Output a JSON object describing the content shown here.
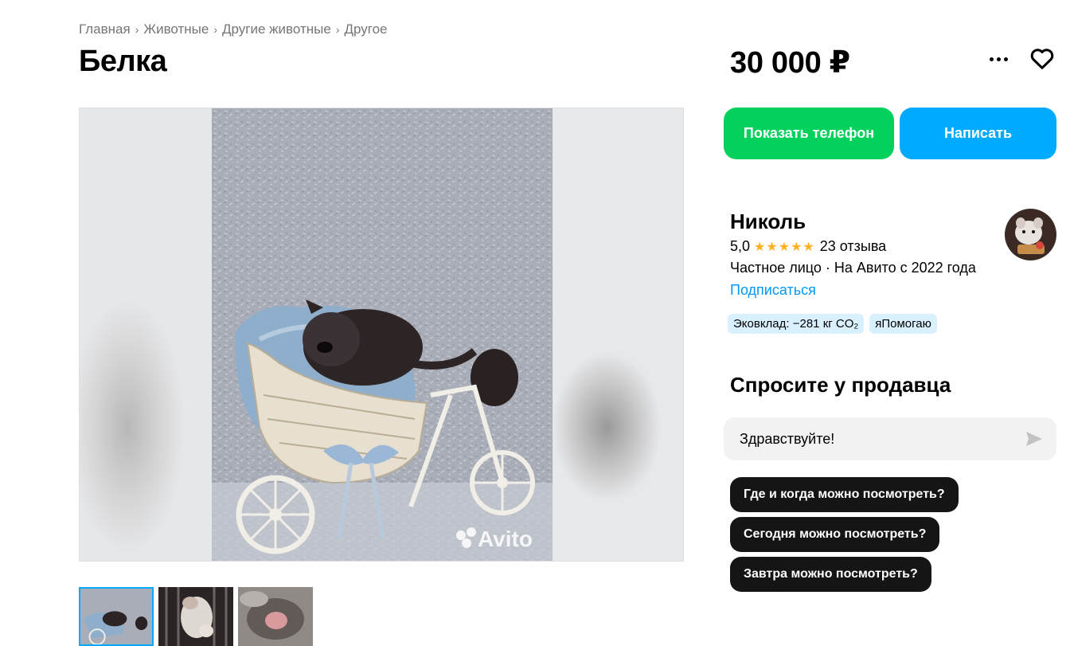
{
  "breadcrumb": [
    "Главная",
    "Животные",
    "Другие животные",
    "Другое"
  ],
  "breadcrumb_separator": "›",
  "listing": {
    "title": "Белка",
    "price": "30 000 ₽",
    "watermark": "Avito"
  },
  "actions": {
    "more_icon": "more-horizontal-icon",
    "favorite_icon": "heart-icon",
    "show_phone": "Показать телефон",
    "write": "Написать"
  },
  "colors": {
    "green": "#02d15c",
    "blue": "#00aaff",
    "link": "#0099f7",
    "star": "#ffb021",
    "badge_bg": "#d9f1ff",
    "chip_bg": "#151515"
  },
  "seller": {
    "name": "Николь",
    "rating": "5,0",
    "stars": "★★★★★",
    "reviews": "23 отзыва",
    "type": "Частное лицо · На Авито с 2022 года",
    "subscribe": "Подписаться",
    "badges": [
      "Эковклад: −281 кг CO₂",
      "яПомогаю"
    ]
  },
  "ask": {
    "title": "Спросите у продавца",
    "message_value": "Здравствуйте!",
    "send_icon": "send-icon",
    "quick_questions": [
      "Где и когда можно посмотреть?",
      "Сегодня можно посмотреть?",
      "Завтра можно посмотреть?"
    ]
  }
}
